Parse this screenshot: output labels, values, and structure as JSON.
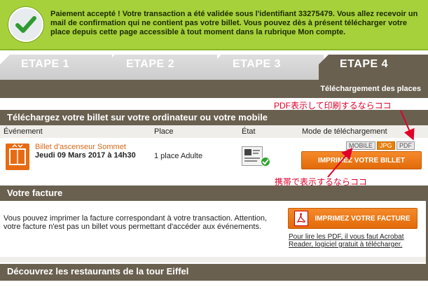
{
  "success": {
    "message": "Paiement accepté ! Votre transaction a été validée sous l'identifiant 33275479. Vous allez recevoir un mail de confirmation qui ne contient pas votre billet. Vous pouvez dès à présent télécharger votre place depuis cette page accessible à tout moment dans la rubrique Mon compte."
  },
  "steps": {
    "items": [
      "ETAPE 1",
      "ETAPE 2",
      "ETAPE 3",
      "ETAPE 4"
    ],
    "subtitle": "Téléchargement des places"
  },
  "ticket_section": {
    "title": "Téléchargez votre billet sur votre ordinateur ou votre mobile",
    "columns": [
      "Événement",
      "Place",
      "État",
      "Mode de téléchargement"
    ],
    "row": {
      "name": "Billet d'ascenseur Sommet",
      "date": "Jeudi 09 Mars 2017 à 14h30",
      "place": "1 place Adulte"
    },
    "modes": [
      "MOBILE",
      "JPG",
      "PDF"
    ],
    "print_button": "IMPRIMEZ VOTRE BILLET"
  },
  "annotations": {
    "pdf_note": "PDF表示して印刷するならココ",
    "mobile_note": "携帯で表示するならココ"
  },
  "invoice_section": {
    "title": "Votre facture",
    "text": "Vous pouvez imprimer la facture correspondant à votre transaction. Attention, votre facture n'est pas un billet vous permettant d'accéder aux événements.",
    "print_button": "IMPRIMEZ VOTRE FACTURE",
    "acrobat_link": "Pour lire les PDF, il vous faut Acrobat Reader, logiciel gratuit à télécharger."
  },
  "restaurants_section": {
    "title": "Découvrez les restaurants de la tour Eiffel"
  },
  "colors": {
    "success_bg": "#a6d13a",
    "header_brown": "#6a6050",
    "accent_orange": "#e8800c",
    "annotation_red": "#e0002a"
  }
}
